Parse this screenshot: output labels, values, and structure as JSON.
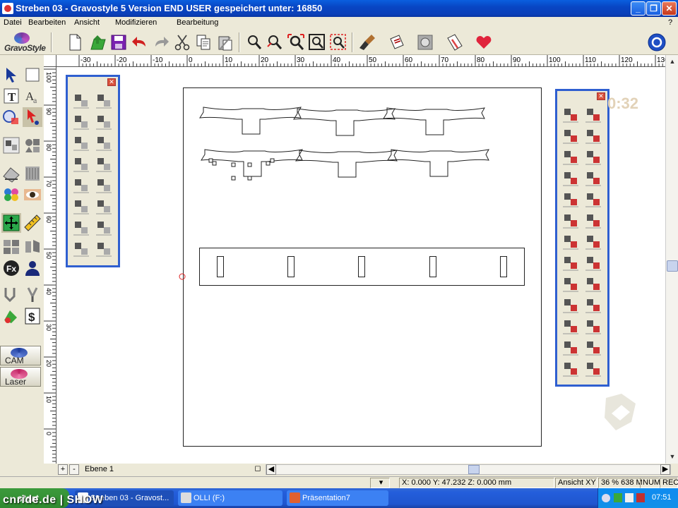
{
  "window": {
    "title": "Streben 03 - Gravostyle 5  Version END USER gespeichert unter: 16850",
    "minimize": "_",
    "maximize": "❐",
    "close": "✕"
  },
  "menu": {
    "items": [
      "Datei",
      "Bearbeiten",
      "Ansicht",
      "Modifizieren",
      "Bearbeitung"
    ],
    "help": "?"
  },
  "logo": {
    "text": "GravoStyle"
  },
  "toolbar": {
    "icons": [
      "new-file-icon",
      "open-file-icon",
      "save-icon",
      "undo-icon",
      "redo-icon",
      "cut-icon",
      "copy-icon",
      "paste-icon",
      "zoom-icon",
      "zoom-in-icon",
      "zoom-box-icon",
      "zoom-page-icon",
      "zoom-selection-icon",
      "brush-icon",
      "engrave-icon",
      "stamp-icon",
      "edit-icon",
      "heart-icon",
      "globe-icon"
    ]
  },
  "ruler": {
    "horizontal": [
      "-30",
      "-20",
      "-10",
      "0",
      "10",
      "20",
      "30",
      "40",
      "50",
      "60",
      "70",
      "80",
      "90",
      "100",
      "110",
      "120",
      "130"
    ],
    "vertical": [
      "100",
      "90",
      "80",
      "70",
      "60",
      "50",
      "40",
      "30",
      "20",
      "10",
      "0"
    ]
  },
  "left_tabs": {
    "cam": "CAM",
    "laser": "Laser"
  },
  "layer": {
    "name": "Ebene 1",
    "add": "+",
    "remove": "-"
  },
  "status": {
    "coords": "X: 0.000   Y: 47.232   Z: 0.000 mm",
    "view": "Ansicht XY",
    "zoom": "36 % 638 M",
    "num": "NUM",
    "rec": "REC"
  },
  "taskbar": {
    "start": "start",
    "tasks": [
      "Streben 03 - Gravost...",
      "OLLI (F:)",
      "Präsentation7"
    ],
    "clock": "07:51"
  },
  "watermark": "cnride.de | SHOW",
  "ghost": {
    "time": "0:32"
  },
  "colors": {
    "titlebar": "#0a3fb8",
    "palette_border": "#2f5fd0",
    "taskbar": "#245edb"
  }
}
